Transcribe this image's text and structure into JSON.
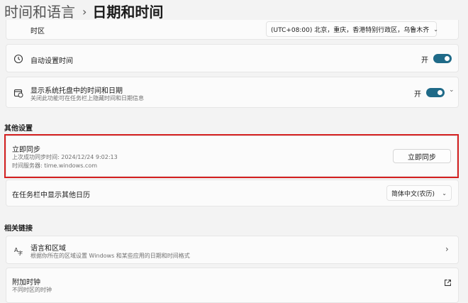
{
  "breadcrumb": {
    "parent": "时间和语言",
    "separator": "›",
    "current": "日期和时间"
  },
  "timezone": {
    "label": "时区",
    "value": "(UTC+08:00) 北京，重庆，香港特别行政区，乌鲁木齐"
  },
  "auto_time": {
    "label": "自动设置时间",
    "toggle_text": "开",
    "on": true
  },
  "tray_time": {
    "label": "显示系统托盘中的时间和日期",
    "sublabel": "关闭此功能可在任务栏上隐藏时间和日期信息",
    "toggle_text": "开",
    "on": true
  },
  "other_settings": {
    "header": "其他设置",
    "sync": {
      "title": "立即同步",
      "last_sync": "上次成功同步时间: 2024/12/24 9:02:13",
      "server": "时间服务器: time.windows.com",
      "button": "立即同步"
    },
    "calendar": {
      "label": "在任务栏中显示其他日历",
      "value": "简体中文(农历)"
    }
  },
  "related_links": {
    "header": "相关链接",
    "language_region": {
      "title": "语言和区域",
      "sublabel": "根据你所在的区域设置 Windows 和某些应用的日期和时间格式"
    },
    "additional_clocks": {
      "title": "附加时钟",
      "sublabel": "不同时区的时钟"
    }
  },
  "colors": {
    "accent": "#1f6a88",
    "highlight": "#d42020"
  }
}
